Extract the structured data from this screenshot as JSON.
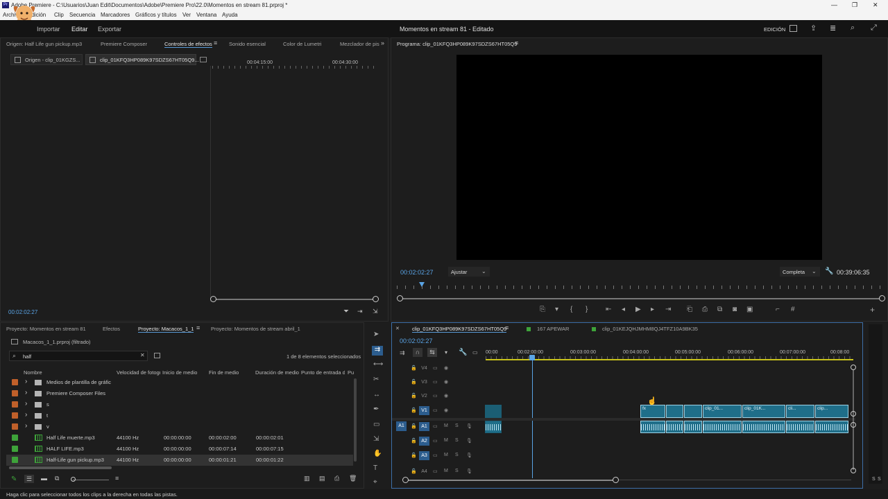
{
  "app": {
    "title": "Adobe Premiere - C:\\Usuarios\\Juan Edit\\Documentos\\Adobe\\Premiere Pro\\22.0\\Momentos en stream 81.prproj *",
    "menu": [
      "Archivo",
      "Edición",
      "Clip",
      "Secuencia",
      "Marcadores",
      "Gráficos y títulos",
      "Ver",
      "Ventana",
      "Ayuda"
    ],
    "window_controls": [
      "—",
      "❐",
      "✕"
    ]
  },
  "workspace": {
    "tabs": [
      "Importar",
      "Editar",
      "Exportar"
    ],
    "project_title": "Momentos en stream 81 - Editado",
    "mode": "EDICIÓN"
  },
  "source_panel": {
    "tabs": [
      "Origen: Half Life gun pickup.mp3",
      "Premiere Composer",
      "Controles de efectos",
      "Sonido esencial",
      "Color de Lumetri",
      "Mezclador de pis"
    ],
    "subtabs": [
      "Origen - clip_01KGZS...",
      "clip_01KFQ3HP089K97SDZS67HT05Q9..."
    ],
    "ruler": [
      "00:04:15:00",
      "00:04:30:00"
    ],
    "timecode": "00:02:02:27"
  },
  "program_panel": {
    "title": "Programa: clip_01KFQ3HP089K97SDZS67HT05Q9",
    "timecode": "00:02:02:27",
    "fit": "Ajustar",
    "quality": "Completa",
    "duration": "00:39:06:35",
    "playhead_fraction": 0.052
  },
  "project_panel": {
    "tabs": [
      "Proyecto: Momentos en stream 81",
      "Efectos",
      "Proyecto: Macacos_1_1",
      "Proyecto: Momentos de stream abril_1"
    ],
    "file": "Macacos_1_1.prproj (filtrado)",
    "search_value": "half",
    "selection_info": "1 de 8 elementos seleccionados",
    "columns": [
      "Nombre",
      "Velocidad de fotogr",
      "Inicio de medio",
      "Fin de medio",
      "Duración de medio",
      "Punto de entrada d",
      "Pu"
    ],
    "rows": [
      {
        "name": "Medios de plantilla de gráfic",
        "type": "folder",
        "color": "#c0602a",
        "rate": "",
        "start": "",
        "end": "",
        "dur": ""
      },
      {
        "name": "Premiere Composer Files",
        "type": "folder",
        "color": "#c0602a",
        "rate": "",
        "start": "",
        "end": "",
        "dur": ""
      },
      {
        "name": "s",
        "type": "folder",
        "color": "#c0602a",
        "rate": "",
        "start": "",
        "end": "",
        "dur": ""
      },
      {
        "name": "t",
        "type": "folder",
        "color": "#c0602a",
        "rate": "",
        "start": "",
        "end": "",
        "dur": ""
      },
      {
        "name": "v",
        "type": "folder",
        "color": "#c0602a",
        "rate": "",
        "start": "",
        "end": "",
        "dur": ""
      },
      {
        "name": "Half Life muerte.mp3",
        "type": "audio",
        "color": "#3ea33a",
        "rate": "44100 Hz",
        "start": "00:00:00:00",
        "end": "00:00:02:00",
        "dur": "00:00:02:01"
      },
      {
        "name": "HALF LIFE.mp3",
        "type": "audio",
        "color": "#3ea33a",
        "rate": "44100 Hz",
        "start": "00:00:00:00",
        "end": "00:00:07:14",
        "dur": "00:00:07:15"
      },
      {
        "name": "Half-Life gun pickup.mp3",
        "type": "audio",
        "color": "#3ea33a",
        "rate": "44100 Hz",
        "start": "00:00:00:00",
        "end": "00:00:01:21",
        "dur": "00:00:01:22"
      }
    ]
  },
  "timeline": {
    "tabs": [
      "clip_01KFQ3HP089K97SDZS67HT05Q9",
      "167 APEWAR",
      "clip_01KEJQHJMHM8QJ4TFZ10A9BK35"
    ],
    "timecode": "00:02:02:27",
    "ruler": [
      "00:00",
      "00:02:00:00",
      "00:03:00:00",
      "00:04:00:00",
      "00:05:00:00",
      "00:06:00:00",
      "00:07:00:00",
      "00:08:00"
    ],
    "video_tracks": [
      "V4",
      "V3",
      "V2",
      "V1"
    ],
    "audio_tracks": [
      "A1",
      "A2",
      "A3",
      "A4"
    ],
    "source_patch": "A1",
    "clip_labels": [
      "clip_01...",
      "clip_01K...",
      "cli...",
      "clip..."
    ],
    "meter_labels": [
      "S",
      "S"
    ]
  },
  "status_text": "Haga clic para seleccionar todos los clips a la derecha en todas las pistas.",
  "colors": {
    "accent": "#5aa4e6",
    "clip": "#1f6e89",
    "label_orange": "#c0602a",
    "label_green": "#3ea33a"
  }
}
